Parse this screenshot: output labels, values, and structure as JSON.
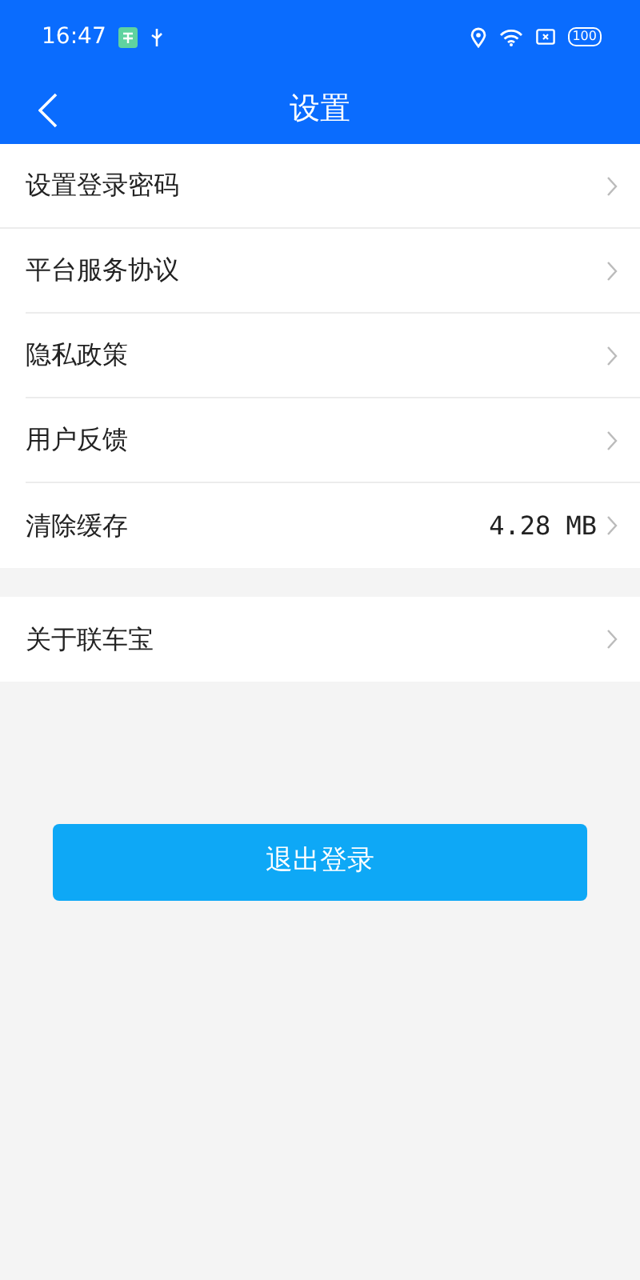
{
  "status_bar": {
    "time": "16:47",
    "battery": "100"
  },
  "header": {
    "title": "设置"
  },
  "groups": [
    {
      "items": [
        {
          "label": "设置登录密码"
        },
        {
          "label": "平台服务协议"
        },
        {
          "label": "隐私政策"
        },
        {
          "label": "用户反馈"
        },
        {
          "label": "清除缓存",
          "value": "4.28 MB"
        }
      ]
    },
    {
      "items": [
        {
          "label": "关于联车宝"
        }
      ]
    }
  ],
  "logout_button": "退出登录"
}
